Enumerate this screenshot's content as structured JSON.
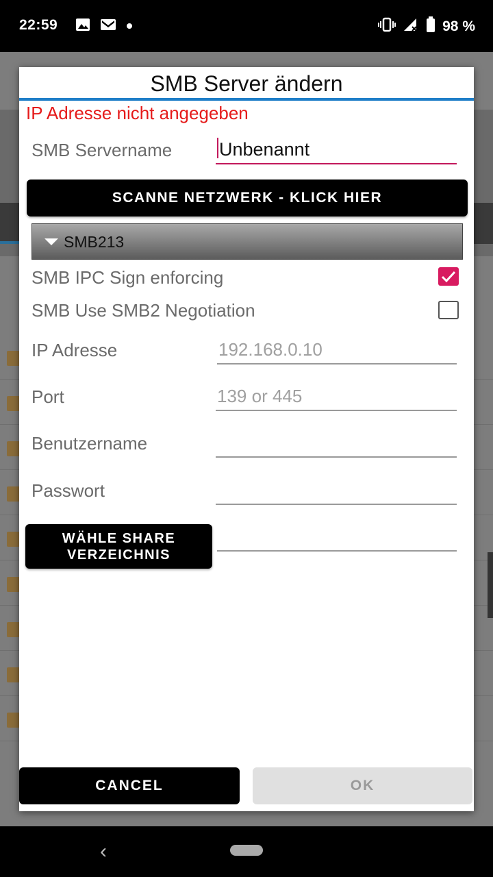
{
  "status_bar": {
    "time": "22:59",
    "battery_percent": "98 %",
    "icons": [
      "image-icon",
      "gmail-icon",
      "dot-icon",
      "vibrate-icon",
      "signal-icon",
      "battery-icon"
    ]
  },
  "dialog": {
    "title": "SMB Server ändern",
    "error": "IP Adresse nicht angegeben",
    "servername_label": "SMB Servername",
    "servername_value": "Unbenannt",
    "scan_button": "SCANNE NETZWERK - KLICK HIER",
    "smb_version": "SMB213",
    "ipc_sign_label": "SMB IPC Sign enforcing",
    "ipc_sign_checked": true,
    "smb2_label": "SMB Use SMB2 Negotiation",
    "smb2_checked": false,
    "ip_label": "IP Adresse",
    "ip_placeholder": "192.168.0.10",
    "port_label": "Port",
    "port_placeholder": "139 or 445",
    "user_label": "Benutzername",
    "user_value": "",
    "password_label": "Passwort",
    "password_value": "",
    "share_button_line1": "WÄHLE SHARE",
    "share_button_line2": "VERZEICHNIS",
    "share_value": "",
    "cancel_label": "CANCEL",
    "ok_label": "OK"
  },
  "colors": {
    "accent": "#c2185b",
    "checkbox_checked": "#d81b60",
    "error": "#e51b1b",
    "title_divider": "#1e7ec8"
  }
}
